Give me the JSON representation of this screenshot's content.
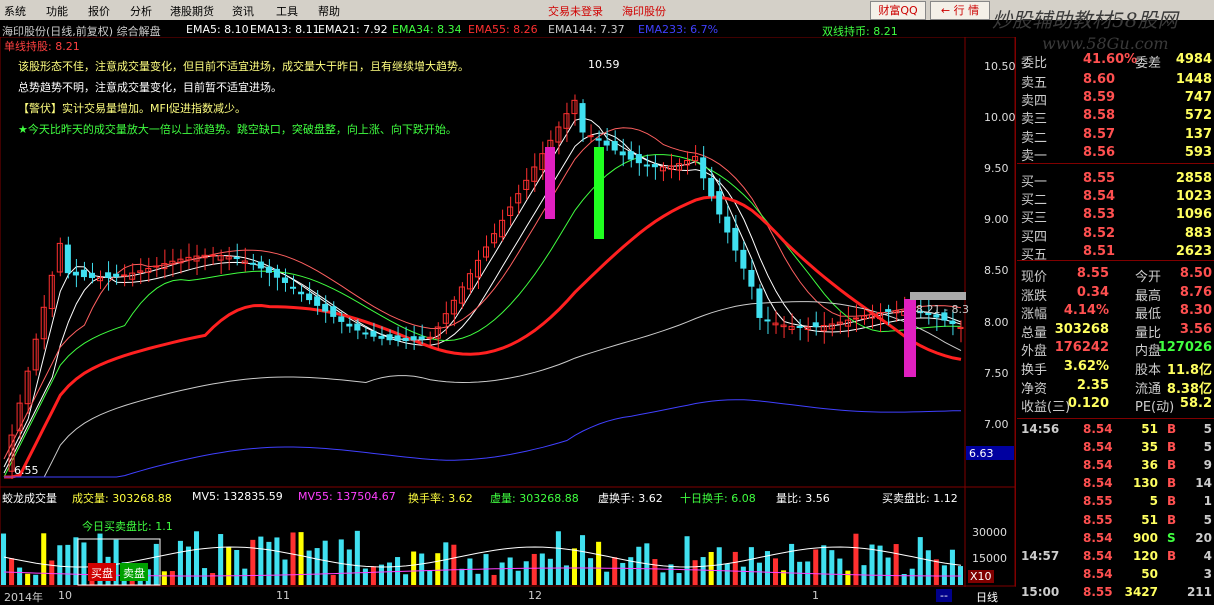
{
  "menu": [
    "系统",
    "功能",
    "报价",
    "分析",
    "港股期货",
    "资讯",
    "工具",
    "帮助"
  ],
  "alert_text": "交易未登录",
  "broker": "海印股份",
  "buttons": {
    "caifu": "财富QQ",
    "hangqing": "← 行 情"
  },
  "watermark": {
    "cn": "炒股辅助教材58股网",
    "url": "www.58Gu.com"
  },
  "chart_title": "海印股份(日线,前复权) 综合解盘",
  "ema": [
    {
      "label": "EMA5: 8.10",
      "color": "#ffffff"
    },
    {
      "label": "EMA13: 8.11",
      "color": "#ffffff"
    },
    {
      "label": "EMA21: 7.92",
      "color": "#ffffff"
    },
    {
      "label": "EMA34: 8.34",
      "color": "#40ff40"
    },
    {
      "label": "EMA55: 8.26",
      "color": "#ff3030"
    },
    {
      "label": "EMA144: 7.37",
      "color": "#cccccc"
    },
    {
      "label": "EMA233: 6.7%",
      "color": "#4040ff"
    }
  ],
  "right_indicator": "双线持币: 8.21",
  "left_indicator": "单线持股: 8.21",
  "signals": [
    {
      "text": "该股形态不佳，注意成交量变化，但目前不适宜进场，成交量大于昨日，且有继续增大趋势。",
      "color": "#ffff80"
    },
    {
      "text": "总势趋势不明，注意成交量变化，目前暂不适宜进场。",
      "color": "#ffffff"
    },
    {
      "text": "【警伏】实计交易量增加。MFI促进指数减少。",
      "color": "#ffff80"
    },
    {
      "text": "★今天比昨天的成交量放大一倍以上涨趋势。跳空缺口，突破盘整，向上涨、向下跌开始。",
      "color": "#40ff40"
    }
  ],
  "price_axis": [
    "10.50",
    "10.00",
    "9.50",
    "9.00",
    "8.50",
    "8.00",
    "7.50",
    "7.00"
  ],
  "price_marker": "6.63",
  "annotations": {
    "high": "10.59",
    "low": "6.55",
    "current": "8.21 - 8.3"
  },
  "vol_header": [
    {
      "label": "蛟龙成交量",
      "color": "#ffffff"
    },
    {
      "label": "成交量: 303268.88",
      "color": "#ffff40"
    },
    {
      "label": "MV5: 132835.59",
      "color": "#ffffff"
    },
    {
      "label": "MV55: 137504.67",
      "color": "#ff40ff"
    },
    {
      "label": "换手率: 3.62",
      "color": "#ffff40"
    },
    {
      "label": "虚量: 303268.88",
      "color": "#40ff40"
    },
    {
      "label": "虚换手: 3.62",
      "color": "#ffffff"
    },
    {
      "label": "十日换手: 6.08",
      "color": "#40ff40"
    },
    {
      "label": "量比: 3.56",
      "color": "#ffffff"
    },
    {
      "label": "买卖盘比: 1.12",
      "color": "#ffffff"
    }
  ],
  "vol_inner": {
    "ratio": "今日买卖盘比: 1.1",
    "buy": "买盘",
    "sell": "卖盘"
  },
  "vol_axis": [
    "30000",
    "15000"
  ],
  "vol_unit": "X10",
  "date_axis": [
    "2014年",
    "10",
    "11",
    "12",
    "1"
  ],
  "period": "日线",
  "quote": {
    "top_label": "委比",
    "top_val": "41.60%",
    "top_label2": "委差",
    "top_val2": "4984",
    "asks": [
      {
        "label": "卖五",
        "price": "8.60",
        "vol": "1448"
      },
      {
        "label": "卖四",
        "price": "8.59",
        "vol": "747"
      },
      {
        "label": "卖三",
        "price": "8.58",
        "vol": "572"
      },
      {
        "label": "卖二",
        "price": "8.57",
        "vol": "137"
      },
      {
        "label": "卖一",
        "price": "8.56",
        "vol": "593"
      }
    ],
    "bids": [
      {
        "label": "买一",
        "price": "8.55",
        "vol": "2858"
      },
      {
        "label": "买二",
        "price": "8.54",
        "vol": "1023"
      },
      {
        "label": "买三",
        "price": "8.53",
        "vol": "1096"
      },
      {
        "label": "买四",
        "price": "8.52",
        "vol": "883"
      },
      {
        "label": "买五",
        "price": "8.51",
        "vol": "2623"
      }
    ],
    "stats": [
      {
        "l1": "现价",
        "v1": "8.55",
        "l2": "今开",
        "v2": "8.50",
        "c1": "#ff5050",
        "c2": "#ff5050"
      },
      {
        "l1": "涨跌",
        "v1": "0.34",
        "l2": "最高",
        "v2": "8.76",
        "c1": "#ff5050",
        "c2": "#ff5050"
      },
      {
        "l1": "涨幅",
        "v1": "4.14%",
        "l2": "最低",
        "v2": "8.30",
        "c1": "#ff5050",
        "c2": "#ff5050"
      },
      {
        "l1": "总量",
        "v1": "303268",
        "l2": "量比",
        "v2": "3.56",
        "c1": "#ffff60",
        "c2": "#ff5050"
      },
      {
        "l1": "外盘",
        "v1": "176242",
        "l2": "内盘",
        "v2": "127026",
        "c1": "#ff5050",
        "c2": "#40ff40"
      },
      {
        "l1": "换手",
        "v1": "3.62%",
        "l2": "股本",
        "v2": "11.8亿",
        "c1": "#ffff60",
        "c2": "#ffff60"
      },
      {
        "l1": "净资",
        "v1": "2.35",
        "l2": "流通",
        "v2": "8.38亿",
        "c1": "#ffff60",
        "c2": "#ffff60"
      },
      {
        "l1": "收益(三)",
        "v1": "0.120",
        "l2": "PE(动)",
        "v2": "58.2",
        "c1": "#ffff60",
        "c2": "#ffff60"
      }
    ],
    "ticks": [
      {
        "time": "14:56",
        "price": "8.54",
        "vol": "51",
        "side": "B",
        "n": "5"
      },
      {
        "time": "",
        "price": "8.54",
        "vol": "35",
        "side": "B",
        "n": "5"
      },
      {
        "time": "",
        "price": "8.54",
        "vol": "36",
        "side": "B",
        "n": "9"
      },
      {
        "time": "",
        "price": "8.54",
        "vol": "130",
        "side": "B",
        "n": "14"
      },
      {
        "time": "",
        "price": "8.55",
        "vol": "5",
        "side": "B",
        "n": "1"
      },
      {
        "time": "",
        "price": "8.55",
        "vol": "51",
        "side": "B",
        "n": "5"
      },
      {
        "time": "",
        "price": "8.54",
        "vol": "900",
        "side": "S",
        "n": "20"
      },
      {
        "time": "14:57",
        "price": "8.54",
        "vol": "120",
        "side": "B",
        "n": "4"
      },
      {
        "time": "",
        "price": "8.54",
        "vol": "50",
        "side": "",
        "n": "3"
      },
      {
        "time": "15:00",
        "price": "8.55",
        "vol": "3427",
        "side": "",
        "n": "211"
      }
    ]
  }
}
